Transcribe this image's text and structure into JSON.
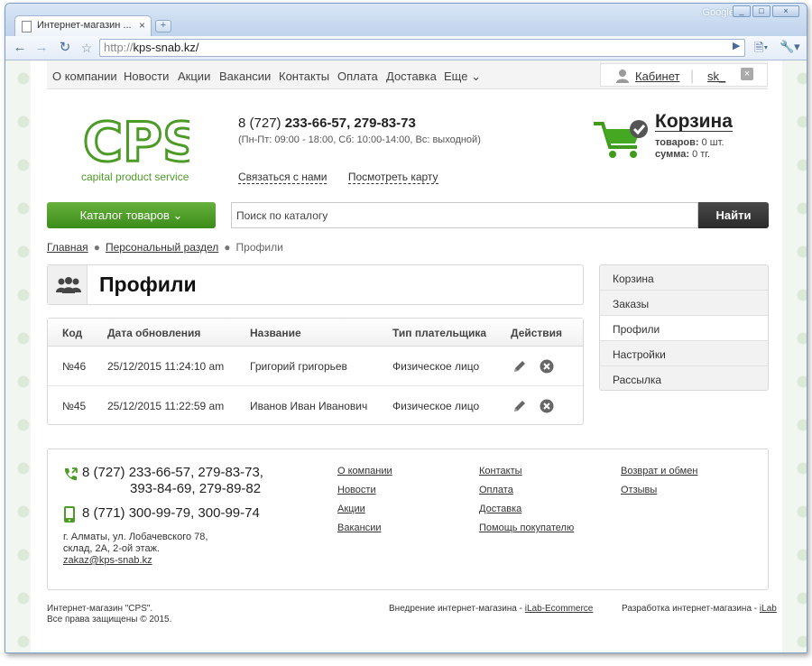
{
  "browser": {
    "tab_title": "Интернет-магазин ...",
    "tab_close": "×",
    "new_tab": "+",
    "google_label": "Google",
    "url_protocol": "http://",
    "url_host": "kps-snab.kz/",
    "window_buttons": [
      "_",
      "□",
      "×"
    ]
  },
  "topnav": {
    "items": [
      "О компании",
      "Новости",
      "Акции",
      "Вакансии",
      "Контакты",
      "Оплата",
      "Доставка",
      "Еще"
    ],
    "cabinet_label": "Кабинет",
    "user_label": "sk_",
    "close_label": "×"
  },
  "logo": {
    "letters": "CPS",
    "tagline": "capital product service"
  },
  "header": {
    "phone_prefix": "8 (727) ",
    "phone_numbers": "233-66-57, 279-83-73",
    "hours": "(Пн-Пт: 09:00 - 18:00,  Сб: 10:00-14:00, Вс: выходной)",
    "contact_link": "Связаться с нами",
    "map_link": "Посмотреть карту"
  },
  "cart": {
    "title": "Корзина",
    "items_label": "товаров:",
    "items_value": "0 шт.",
    "sum_label": "сумма:",
    "sum_value": "0 тг."
  },
  "catalog_button": "Каталог товаров",
  "search": {
    "placeholder": "Поиск по каталогу",
    "button": "Найти"
  },
  "breadcrumbs": [
    "Главная",
    "Персональный раздел",
    "Профили"
  ],
  "page_title": "Профили",
  "table": {
    "headers": [
      "Код",
      "Дата обновления",
      "Название",
      "Тип плательщика",
      "Действия"
    ],
    "rows": [
      {
        "code": "№46",
        "date": "25/12/2015 11:24:10 am",
        "name": "Григорий григорьев",
        "type": "Физическое лицо"
      },
      {
        "code": "№45",
        "date": "25/12/2015 11:22:59 am",
        "name": "Иванов Иван Иванович",
        "type": "Физическое лицо"
      }
    ]
  },
  "sidebar": {
    "items": [
      "Корзина",
      "Заказы",
      "Профили",
      "Настройки",
      "Рассылка"
    ],
    "active": "Профили"
  },
  "footer": {
    "phone1_line1": "8 (727) 233-66-57, 279-83-73,",
    "phone1_line2": "393-84-69, 279-89-82",
    "phone2": "8 (771) 300-99-79, 300-99-74",
    "address_line1": "г. Алматы, ул. Лобачевского 78,",
    "address_line2": "склад, 2А, 2-ой этаж.",
    "email": "zakaz@kps-snab.kz",
    "col1": [
      "О компании",
      "Новости",
      "Акции",
      "Вакансии"
    ],
    "col2": [
      "Контакты",
      "Оплата",
      "Доставка",
      "Помощь покупателю"
    ],
    "col3": [
      "Возврат и обмен",
      "Отзывы"
    ]
  },
  "bottom": {
    "copyright_line1": "Интернет-магазин \"CPS\".",
    "copyright_line2": "Все права защищены © 2015.",
    "impl_text": "Внедрение интернет-магазина - ",
    "impl_link": "iLab-Ecommerce",
    "dev_text": "Разработка интернет-магазина - ",
    "dev_link": "iLab"
  },
  "colors": {
    "brand_green": "#4c9b26",
    "search_button": "#333333",
    "window_frame": "#7d9ec4"
  }
}
